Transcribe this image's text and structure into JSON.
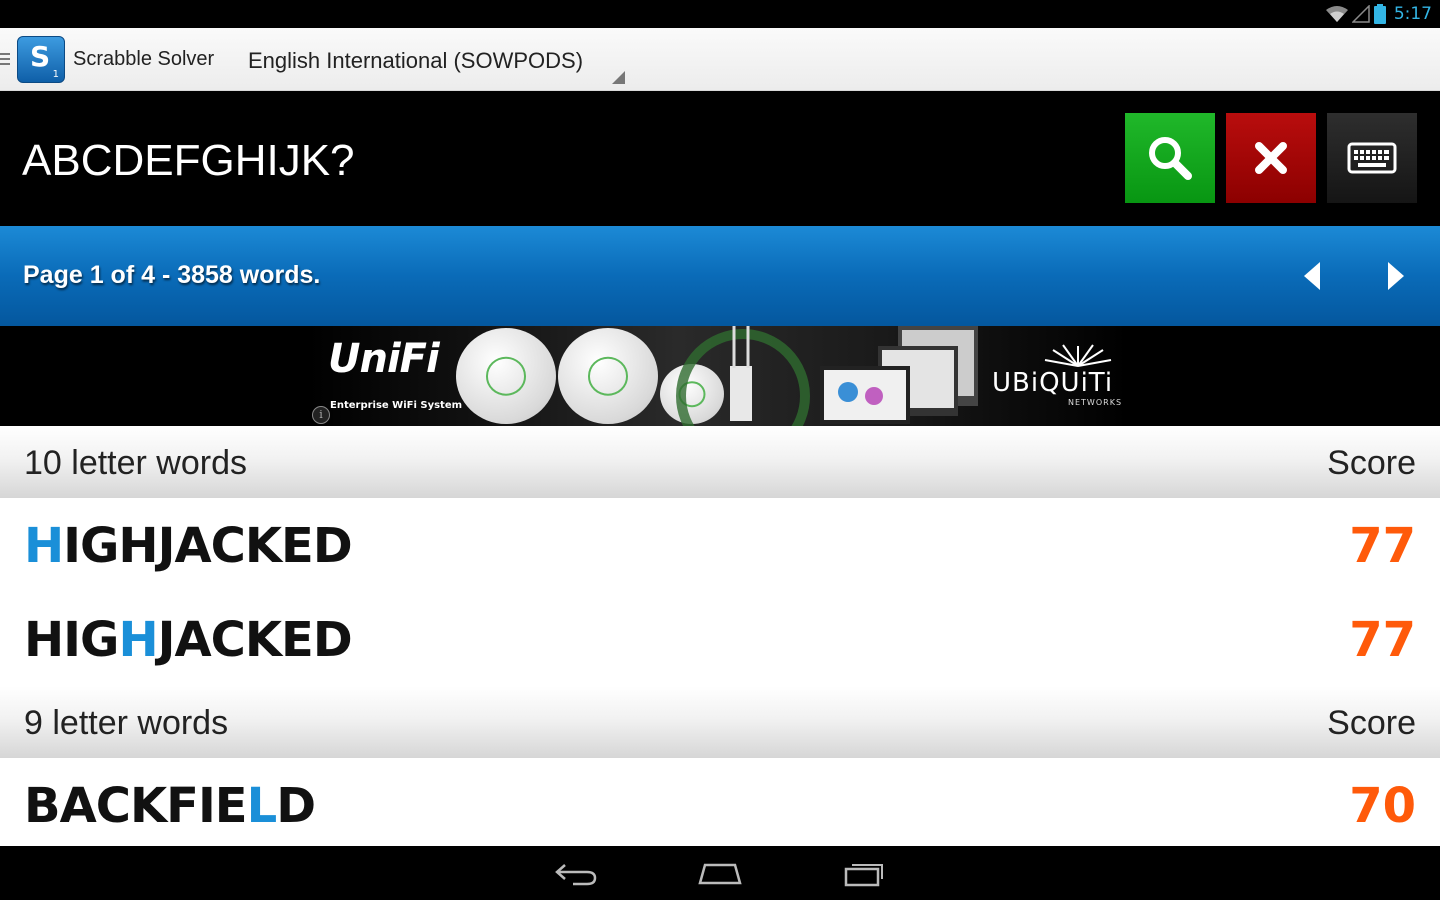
{
  "status_bar": {
    "time": "5:17",
    "icons": [
      "wifi-icon",
      "signal-icon",
      "battery-icon"
    ]
  },
  "action_bar": {
    "logo_letter": "S",
    "logo_number": "1",
    "app_title": "Scrabble Solver",
    "dictionary": "English International (SOWPODS)"
  },
  "search": {
    "letters": "ABCDEFGHIJK?",
    "buttons": [
      "search-icon",
      "close-icon",
      "keyboard-icon"
    ]
  },
  "pager": {
    "info": "Page 1 of 4 - 3858 words."
  },
  "ad": {
    "brand": "UniFi",
    "tagline": "Enterprise WiFi System",
    "company": "UBiQUiTi",
    "company_sub": "NETWORKS"
  },
  "results": {
    "score_header": "Score",
    "groups": [
      {
        "title": "10 letter words",
        "words": [
          {
            "pre": "",
            "blank": "H",
            "post": "IGHJACKED",
            "score": "77"
          },
          {
            "pre": "HIG",
            "blank": "H",
            "post": "JACKED",
            "score": "77"
          }
        ]
      },
      {
        "title": "9 letter words",
        "words": [
          {
            "pre": "BACKFIE",
            "blank": "L",
            "post": "D",
            "score": "70"
          }
        ]
      }
    ]
  },
  "colors": {
    "accent_blue": "#1a8fd8",
    "score_orange": "#ff5a0a",
    "search_green": "#10a81c",
    "clear_red": "#a30000"
  }
}
